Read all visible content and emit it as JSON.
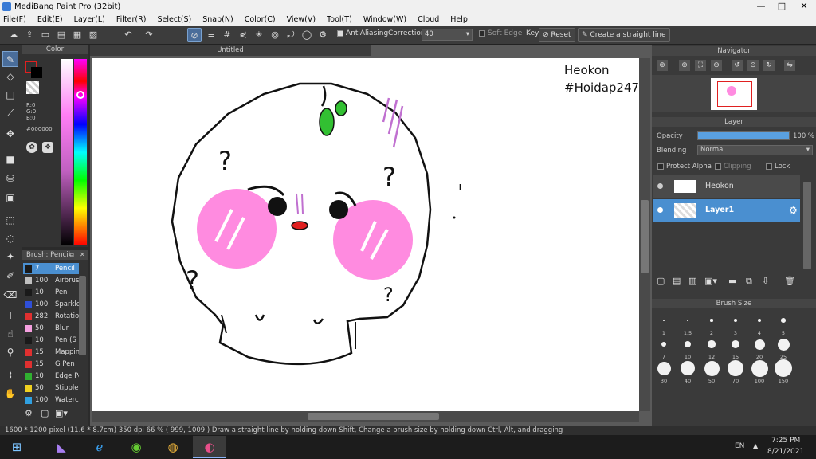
{
  "window": {
    "title": "MediBang Paint Pro (32bit)",
    "minimize": "—",
    "maximize": "□",
    "close": "✕"
  },
  "menu": [
    "File(F)",
    "Edit(E)",
    "Layer(L)",
    "Filter(R)",
    "Select(S)",
    "Snap(N)",
    "Color(C)",
    "View(V)",
    "Tool(T)",
    "Window(W)",
    "Cloud",
    "Help"
  ],
  "toolbar": {
    "antialiasing_label": "AntiAliasing",
    "correction_label": "Correction",
    "correction_value": "40",
    "soft_edge_label": "Soft Edge",
    "key_label": "Key",
    "reset_label": "Reset",
    "straight_line_label": "Create a straight line"
  },
  "color_panel": {
    "title": "Color",
    "r": "R:0",
    "g": "G:0",
    "b": "B:0",
    "hex": "#000000",
    "fg_color": "#000000",
    "bg_color": "#ffffff"
  },
  "brush_panel": {
    "title": "Brush: Pencil",
    "items": [
      {
        "size": "7",
        "name": "Pencil",
        "color": "#1a1a1a",
        "selected": true
      },
      {
        "size": "100",
        "name": "Airbrush",
        "color": "#c0c0c0"
      },
      {
        "size": "10",
        "name": "Pen",
        "color": "#1a1a1a"
      },
      {
        "size": "100",
        "name": "Sparkle",
        "color": "#2f4fd8"
      },
      {
        "size": "282",
        "name": "Rotation",
        "color": "#e03030"
      },
      {
        "size": "50",
        "name": "Blur",
        "color": "#f5a0e0"
      },
      {
        "size": "10",
        "name": "Pen (S",
        "color": "#1a1a1a"
      },
      {
        "size": "15",
        "name": "Mapping",
        "color": "#e03030"
      },
      {
        "size": "15",
        "name": "G Pen",
        "color": "#e03030"
      },
      {
        "size": "10",
        "name": "Edge Pen",
        "color": "#30b030"
      },
      {
        "size": "50",
        "name": "Stipple",
        "color": "#f0d020"
      },
      {
        "size": "100",
        "name": "Watercolor",
        "color": "#30a0e0"
      }
    ]
  },
  "document": {
    "tab_title": "Untitled",
    "watermark_line1": "Heokon",
    "watermark_line2": "#Hoidap247",
    "doodle_marks": [
      "?",
      "?",
      "?",
      "?",
      "'"
    ]
  },
  "navigator": {
    "title": "Navigator"
  },
  "layer_panel": {
    "title": "Layer",
    "opacity_label": "Opacity",
    "opacity_value": "100 %",
    "opacity_fraction": 1.0,
    "blending_label": "Blending",
    "blending_value": "Normal",
    "protect_alpha": "Protect Alpha",
    "clipping": "Clipping",
    "lock": "Lock",
    "layers": [
      {
        "name": "Heokon",
        "selected": false
      },
      {
        "name": "Layer1",
        "selected": true
      }
    ]
  },
  "brush_size_panel": {
    "title": "Brush Size",
    "sizes": [
      "1",
      "1.5",
      "2",
      "3",
      "4",
      "5",
      "7",
      "10",
      "12",
      "15",
      "20",
      "25",
      "30",
      "40",
      "50",
      "70",
      "100",
      "150"
    ]
  },
  "status": {
    "text": "1600 * 1200 pixel   (11.6 * 8.7cm)   350 dpi   66 %   ( 999, 1009 )   Draw a straight line by holding down Shift, Change a brush size by holding down Ctrl, Alt, and dragging"
  },
  "taskbar": {
    "lang": "EN",
    "time": "7:25 PM",
    "date": "8/21/2021"
  }
}
